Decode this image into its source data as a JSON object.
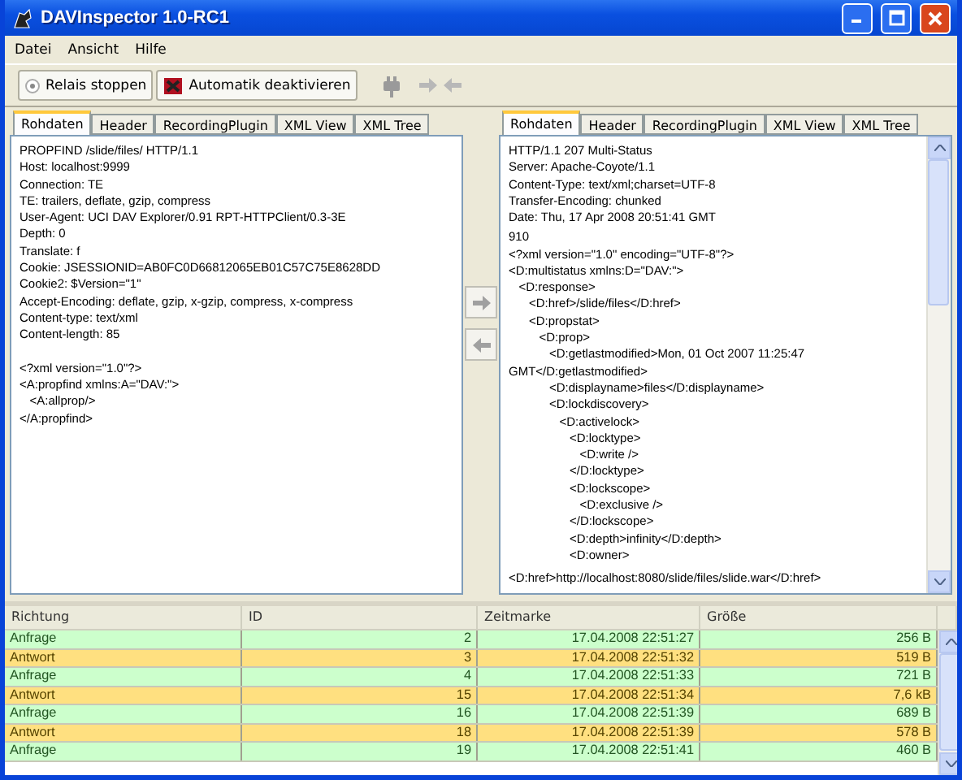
{
  "window": {
    "title": "DAVInspector 1.0-RC1"
  },
  "menu": [
    "Datei",
    "Ansicht",
    "Hilfe"
  ],
  "toolbar": {
    "buttons": [
      {
        "label": "Relais stoppen",
        "kind": "radio"
      },
      {
        "label": "Automatik deaktivieren",
        "kind": "auto"
      }
    ]
  },
  "request_panel": {
    "tabs": [
      {
        "label": "Rohdaten",
        "selected": true
      },
      {
        "label": "Header",
        "selected": false
      },
      {
        "label": "RecordingPlugin",
        "selected": false
      },
      {
        "label": "XML View",
        "selected": false
      },
      {
        "label": "XML Tree",
        "selected": false
      }
    ],
    "headers": [
      "PROPFIND /slide/files/ HTTP/1.1",
      "Host: localhost:9999",
      "Connection: TE",
      "TE: trailers, deflate, gzip, compress",
      "User-Agent: UCI DAV Explorer/0.91 RPT-HTTPClient/0.3-3E",
      "Depth: 0",
      "Translate: f",
      "Cookie: JSESSIONID=AB0FC0D66812065EB01C57C75E8628DD",
      "Cookie2: $Version=\"1\"",
      "Accept-Encoding: deflate, gzip, x-gzip, compress, x-compress",
      "Content-type: text/xml",
      "Content-length: 85"
    ],
    "body": [
      "<?xml version=\"1.0\"?>",
      "<A:propfind xmlns:A=\"DAV:\">",
      "   <A:allprop/>",
      "</A:propfind>"
    ]
  },
  "response_panel": {
    "tabs": [
      {
        "label": "Rohdaten",
        "selected": true
      },
      {
        "label": "Header",
        "selected": false
      },
      {
        "label": "RecordingPlugin",
        "selected": false
      },
      {
        "label": "XML View",
        "selected": false
      },
      {
        "label": "XML Tree",
        "selected": false
      }
    ],
    "headers": [
      "HTTP/1.1 207 Multi-Status",
      "Server: Apache-Coyote/1.1",
      "Content-Type: text/xml;charset=UTF-8",
      "Transfer-Encoding: chunked",
      "Date: Thu, 17 Apr 2008 20:51:41 GMT"
    ],
    "body": [
      "910",
      "<?xml version=\"1.0\" encoding=\"UTF-8\"?>",
      "<D:multistatus xmlns:D=\"DAV:\">",
      "   <D:response>",
      "      <D:href>/slide/files</D:href>",
      "      <D:propstat>",
      "         <D:prop>",
      "            <D:getlastmodified>Mon, 01 Oct 2007 11:25:47",
      "GMT</D:getlastmodified>",
      "            <D:displayname>files</D:displayname>",
      "            <D:lockdiscovery>",
      "               <D:activelock>",
      "                  <D:locktype>",
      "                     <D:write />",
      "                  </D:locktype>",
      "                  <D:lockscope>",
      "                     <D:exclusive />",
      "                  </D:lockscope>",
      "                  <D:depth>infinity</D:depth>",
      "                  <D:owner>"
    ],
    "last_line": "<D:href>http://localhost:8080/slide/files/slide.war</D:href>"
  },
  "table": {
    "columns": [
      "Richtung",
      "ID",
      "Zeitmarke",
      "Größe"
    ],
    "rows": [
      {
        "kind": "request",
        "cells": [
          "Anfrage",
          "2",
          "17.04.2008 22:51:27",
          "256  B"
        ]
      },
      {
        "kind": "response",
        "cells": [
          "Antwort",
          "3",
          "17.04.2008 22:51:32",
          "519  B"
        ]
      },
      {
        "kind": "request",
        "cells": [
          "Anfrage",
          "4",
          "17.04.2008 22:51:33",
          "721  B"
        ]
      },
      {
        "kind": "response",
        "cells": [
          "Antwort",
          "15",
          "17.04.2008 22:51:34",
          "7,6 kB"
        ]
      },
      {
        "kind": "request",
        "cells": [
          "Anfrage",
          "16",
          "17.04.2008 22:51:39",
          "689  B"
        ]
      },
      {
        "kind": "response",
        "cells": [
          "Antwort",
          "18",
          "17.04.2008 22:51:39",
          "578  B"
        ]
      },
      {
        "kind": "request",
        "cells": [
          "Anfrage",
          "19",
          "17.04.2008 22:51:41",
          "460  B"
        ]
      }
    ]
  }
}
